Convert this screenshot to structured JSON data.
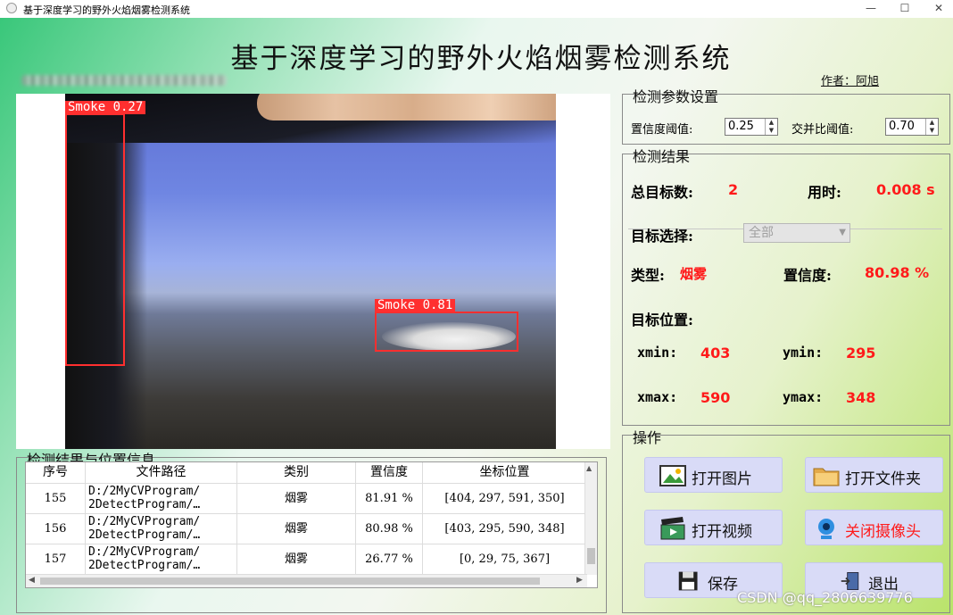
{
  "window": {
    "title": "基于深度学习的野外火焰烟雾检测系统",
    "min_glyph": "—",
    "max_glyph": "☐",
    "close_glyph": "✕"
  },
  "header": {
    "title": "基于深度学习的野外火焰烟雾检测系统",
    "author": "作者：阿旭"
  },
  "detections_overlay": [
    {
      "label": "Smoke 0.27"
    },
    {
      "label": "Smoke 0.81"
    }
  ],
  "params": {
    "group_title": "检测参数设置",
    "conf_label": "置信度阈值:",
    "conf_value": "0.25",
    "iou_label": "交并比阈值:",
    "iou_value": "0.70"
  },
  "results": {
    "group_title": "检测结果",
    "total_label": "总目标数:",
    "total_value": "2",
    "time_label": "用时:",
    "time_value": "0.008 s",
    "select_label": "目标选择:",
    "select_value": "全部",
    "type_label": "类型:",
    "type_value": "烟雾",
    "conf_label": "置信度:",
    "conf_value": "80.98 %",
    "pos_label": "目标位置:",
    "xmin_label": "xmin:",
    "xmin_value": "403",
    "ymin_label": "ymin:",
    "ymin_value": "295",
    "xmax_label": "xmax:",
    "xmax_value": "590",
    "ymax_label": "ymax:",
    "ymax_value": "348"
  },
  "ops": {
    "group_title": "操作",
    "open_image": "打开图片",
    "open_folder": "打开文件夹",
    "open_video": "打开视频",
    "close_camera": "关闭摄像头",
    "save": "保存",
    "exit": "退出"
  },
  "table": {
    "group_title": "检测结果与位置信息",
    "headers": [
      "序号",
      "文件路径",
      "类别",
      "置信度",
      "坐标位置"
    ],
    "rows": [
      {
        "id": "155",
        "path": "D:/2MyCVProgram/\n2DetectProgram/…",
        "cls": "烟雾",
        "conf": "81.91 %",
        "coords": "[404, 297, 591, 350]"
      },
      {
        "id": "156",
        "path": "D:/2MyCVProgram/\n2DetectProgram/…",
        "cls": "烟雾",
        "conf": "80.98 %",
        "coords": "[403, 295, 590, 348]"
      },
      {
        "id": "157",
        "path": "D:/2MyCVProgram/\n2DetectProgram/…",
        "cls": "烟雾",
        "conf": "26.77 %",
        "coords": "[0, 29, 75, 367]"
      }
    ]
  },
  "watermark": "CSDN @qq_2806639776",
  "colors": {
    "accent_red": "#ff1a1a",
    "button_bg": "#d9dbf7",
    "bbox": "#ff2f2f"
  }
}
